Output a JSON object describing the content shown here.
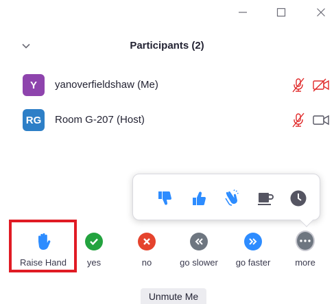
{
  "window": {
    "minimize_icon": "minimize-icon",
    "maximize_icon": "maximize-icon",
    "close_icon": "close-icon"
  },
  "panel": {
    "title": "Participants (2)",
    "collapse_icon": "chevron-down-icon"
  },
  "participants": [
    {
      "initials": "Y",
      "name": "yanoverfieldshaw (Me)",
      "avatar_color": "#8e44ad",
      "mic": "muted",
      "video": "off"
    },
    {
      "initials": "RG",
      "name": "Room G-207 (Host)",
      "avatar_color": "#2d7fc7",
      "mic": "muted",
      "video": "on"
    }
  ],
  "reactions": [
    {
      "name": "thumbs-down"
    },
    {
      "name": "thumbs-up"
    },
    {
      "name": "clapping-hands"
    },
    {
      "name": "coffee"
    },
    {
      "name": "clock"
    }
  ],
  "toolbar": {
    "raise_hand": "Raise Hand",
    "yes": "yes",
    "no": "no",
    "go_slower": "go slower",
    "go_faster": "go faster",
    "more": "more"
  },
  "unmute_label": "Unmute Me",
  "colors": {
    "accent_blue": "#2d8cff",
    "yes_green": "#23a33f",
    "no_red": "#e5432d",
    "slower_gray": "#6e7680",
    "muted_red": "#e02828",
    "highlight_red": "#e01b24"
  }
}
